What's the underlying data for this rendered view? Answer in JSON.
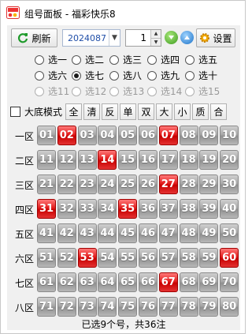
{
  "window": {
    "title": "组号面板 - 福彩快乐8"
  },
  "toolbar": {
    "refresh_label": "刷新",
    "period_value": "2024087",
    "spin_value": "1",
    "settings_label": "设置"
  },
  "radios": [
    [
      {
        "label": "选一",
        "checked": false,
        "enabled": true
      },
      {
        "label": "选二",
        "checked": false,
        "enabled": true
      },
      {
        "label": "选三",
        "checked": false,
        "enabled": true
      },
      {
        "label": "选四",
        "checked": false,
        "enabled": true
      },
      {
        "label": "选五",
        "checked": false,
        "enabled": true
      }
    ],
    [
      {
        "label": "选六",
        "checked": false,
        "enabled": true
      },
      {
        "label": "选七",
        "checked": true,
        "enabled": true
      },
      {
        "label": "选八",
        "checked": false,
        "enabled": true
      },
      {
        "label": "选九",
        "checked": false,
        "enabled": true
      },
      {
        "label": "选十",
        "checked": false,
        "enabled": true
      }
    ],
    [
      {
        "label": "选11",
        "checked": false,
        "enabled": false
      },
      {
        "label": "选12",
        "checked": false,
        "enabled": false
      },
      {
        "label": "选13",
        "checked": false,
        "enabled": false
      },
      {
        "label": "选14",
        "checked": false,
        "enabled": false
      },
      {
        "label": "选15",
        "checked": false,
        "enabled": false
      }
    ]
  ],
  "mode": {
    "checkbox_label": "大底模式",
    "checked": false,
    "buttons": [
      "全",
      "清",
      "反",
      "单",
      "双",
      "大",
      "小",
      "质",
      "合"
    ]
  },
  "zones": [
    {
      "label": "一区",
      "numbers": [
        "01",
        "02",
        "03",
        "04",
        "05",
        "06",
        "07",
        "08",
        "09",
        "10"
      ],
      "selected": [
        "02",
        "07"
      ]
    },
    {
      "label": "二区",
      "numbers": [
        "11",
        "12",
        "13",
        "14",
        "15",
        "16",
        "17",
        "18",
        "19",
        "20"
      ],
      "selected": [
        "14"
      ]
    },
    {
      "label": "三区",
      "numbers": [
        "21",
        "22",
        "23",
        "24",
        "25",
        "26",
        "27",
        "28",
        "29",
        "30"
      ],
      "selected": [
        "27"
      ]
    },
    {
      "label": "四区",
      "numbers": [
        "31",
        "32",
        "33",
        "34",
        "35",
        "36",
        "37",
        "38",
        "39",
        "40"
      ],
      "selected": [
        "31",
        "35"
      ]
    },
    {
      "label": "五区",
      "numbers": [
        "41",
        "42",
        "43",
        "44",
        "45",
        "46",
        "47",
        "48",
        "49",
        "50"
      ],
      "selected": []
    },
    {
      "label": "六区",
      "numbers": [
        "51",
        "52",
        "53",
        "54",
        "55",
        "56",
        "57",
        "58",
        "59",
        "60"
      ],
      "selected": [
        "53",
        "60"
      ]
    },
    {
      "label": "七区",
      "numbers": [
        "61",
        "62",
        "63",
        "64",
        "65",
        "66",
        "67",
        "68",
        "69",
        "70"
      ],
      "selected": [
        "67"
      ]
    },
    {
      "label": "八区",
      "numbers": [
        "71",
        "72",
        "73",
        "74",
        "75",
        "76",
        "77",
        "78",
        "79",
        "80"
      ],
      "selected": []
    }
  ],
  "colors": {
    "selected_ball": "#e21c1c",
    "unselected_ball": "#a8a8a8"
  },
  "status": {
    "text": "已选9个号，共36注"
  }
}
